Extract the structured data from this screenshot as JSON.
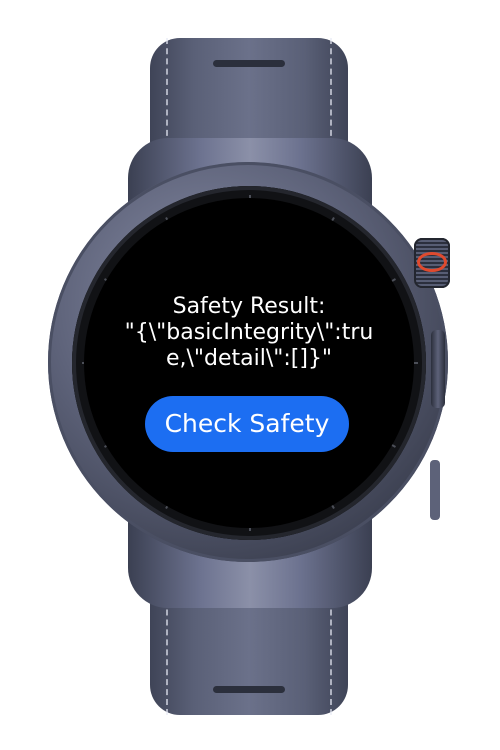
{
  "watch_app": {
    "result_text": "Safety Result:\n\"{\\\"basicIntegrity\\\":true,\\\"detail\\\":[]}\"",
    "check_button_label": "Check Safety"
  },
  "colors": {
    "screen_background": "#000000",
    "button_background": "#1c6ef2",
    "text": "#ffffff",
    "crown_accent": "#e04a2e"
  }
}
